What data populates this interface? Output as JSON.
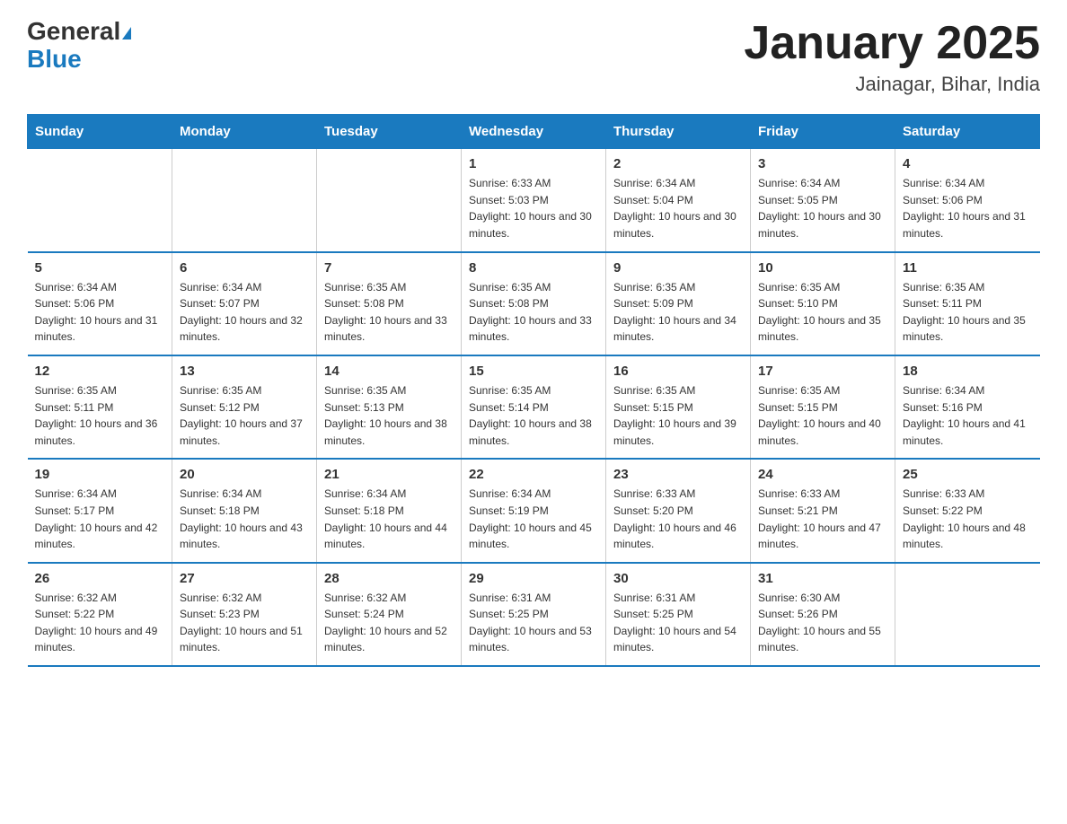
{
  "header": {
    "logo_general": "General",
    "logo_blue": "Blue",
    "month_title": "January 2025",
    "location": "Jainagar, Bihar, India"
  },
  "days_of_week": [
    "Sunday",
    "Monday",
    "Tuesday",
    "Wednesday",
    "Thursday",
    "Friday",
    "Saturday"
  ],
  "weeks": [
    [
      {
        "day": "",
        "sunrise": "",
        "sunset": "",
        "daylight": ""
      },
      {
        "day": "",
        "sunrise": "",
        "sunset": "",
        "daylight": ""
      },
      {
        "day": "",
        "sunrise": "",
        "sunset": "",
        "daylight": ""
      },
      {
        "day": "1",
        "sunrise": "Sunrise: 6:33 AM",
        "sunset": "Sunset: 5:03 PM",
        "daylight": "Daylight: 10 hours and 30 minutes."
      },
      {
        "day": "2",
        "sunrise": "Sunrise: 6:34 AM",
        "sunset": "Sunset: 5:04 PM",
        "daylight": "Daylight: 10 hours and 30 minutes."
      },
      {
        "day": "3",
        "sunrise": "Sunrise: 6:34 AM",
        "sunset": "Sunset: 5:05 PM",
        "daylight": "Daylight: 10 hours and 30 minutes."
      },
      {
        "day": "4",
        "sunrise": "Sunrise: 6:34 AM",
        "sunset": "Sunset: 5:06 PM",
        "daylight": "Daylight: 10 hours and 31 minutes."
      }
    ],
    [
      {
        "day": "5",
        "sunrise": "Sunrise: 6:34 AM",
        "sunset": "Sunset: 5:06 PM",
        "daylight": "Daylight: 10 hours and 31 minutes."
      },
      {
        "day": "6",
        "sunrise": "Sunrise: 6:34 AM",
        "sunset": "Sunset: 5:07 PM",
        "daylight": "Daylight: 10 hours and 32 minutes."
      },
      {
        "day": "7",
        "sunrise": "Sunrise: 6:35 AM",
        "sunset": "Sunset: 5:08 PM",
        "daylight": "Daylight: 10 hours and 33 minutes."
      },
      {
        "day": "8",
        "sunrise": "Sunrise: 6:35 AM",
        "sunset": "Sunset: 5:08 PM",
        "daylight": "Daylight: 10 hours and 33 minutes."
      },
      {
        "day": "9",
        "sunrise": "Sunrise: 6:35 AM",
        "sunset": "Sunset: 5:09 PM",
        "daylight": "Daylight: 10 hours and 34 minutes."
      },
      {
        "day": "10",
        "sunrise": "Sunrise: 6:35 AM",
        "sunset": "Sunset: 5:10 PM",
        "daylight": "Daylight: 10 hours and 35 minutes."
      },
      {
        "day": "11",
        "sunrise": "Sunrise: 6:35 AM",
        "sunset": "Sunset: 5:11 PM",
        "daylight": "Daylight: 10 hours and 35 minutes."
      }
    ],
    [
      {
        "day": "12",
        "sunrise": "Sunrise: 6:35 AM",
        "sunset": "Sunset: 5:11 PM",
        "daylight": "Daylight: 10 hours and 36 minutes."
      },
      {
        "day": "13",
        "sunrise": "Sunrise: 6:35 AM",
        "sunset": "Sunset: 5:12 PM",
        "daylight": "Daylight: 10 hours and 37 minutes."
      },
      {
        "day": "14",
        "sunrise": "Sunrise: 6:35 AM",
        "sunset": "Sunset: 5:13 PM",
        "daylight": "Daylight: 10 hours and 38 minutes."
      },
      {
        "day": "15",
        "sunrise": "Sunrise: 6:35 AM",
        "sunset": "Sunset: 5:14 PM",
        "daylight": "Daylight: 10 hours and 38 minutes."
      },
      {
        "day": "16",
        "sunrise": "Sunrise: 6:35 AM",
        "sunset": "Sunset: 5:15 PM",
        "daylight": "Daylight: 10 hours and 39 minutes."
      },
      {
        "day": "17",
        "sunrise": "Sunrise: 6:35 AM",
        "sunset": "Sunset: 5:15 PM",
        "daylight": "Daylight: 10 hours and 40 minutes."
      },
      {
        "day": "18",
        "sunrise": "Sunrise: 6:34 AM",
        "sunset": "Sunset: 5:16 PM",
        "daylight": "Daylight: 10 hours and 41 minutes."
      }
    ],
    [
      {
        "day": "19",
        "sunrise": "Sunrise: 6:34 AM",
        "sunset": "Sunset: 5:17 PM",
        "daylight": "Daylight: 10 hours and 42 minutes."
      },
      {
        "day": "20",
        "sunrise": "Sunrise: 6:34 AM",
        "sunset": "Sunset: 5:18 PM",
        "daylight": "Daylight: 10 hours and 43 minutes."
      },
      {
        "day": "21",
        "sunrise": "Sunrise: 6:34 AM",
        "sunset": "Sunset: 5:18 PM",
        "daylight": "Daylight: 10 hours and 44 minutes."
      },
      {
        "day": "22",
        "sunrise": "Sunrise: 6:34 AM",
        "sunset": "Sunset: 5:19 PM",
        "daylight": "Daylight: 10 hours and 45 minutes."
      },
      {
        "day": "23",
        "sunrise": "Sunrise: 6:33 AM",
        "sunset": "Sunset: 5:20 PM",
        "daylight": "Daylight: 10 hours and 46 minutes."
      },
      {
        "day": "24",
        "sunrise": "Sunrise: 6:33 AM",
        "sunset": "Sunset: 5:21 PM",
        "daylight": "Daylight: 10 hours and 47 minutes."
      },
      {
        "day": "25",
        "sunrise": "Sunrise: 6:33 AM",
        "sunset": "Sunset: 5:22 PM",
        "daylight": "Daylight: 10 hours and 48 minutes."
      }
    ],
    [
      {
        "day": "26",
        "sunrise": "Sunrise: 6:32 AM",
        "sunset": "Sunset: 5:22 PM",
        "daylight": "Daylight: 10 hours and 49 minutes."
      },
      {
        "day": "27",
        "sunrise": "Sunrise: 6:32 AM",
        "sunset": "Sunset: 5:23 PM",
        "daylight": "Daylight: 10 hours and 51 minutes."
      },
      {
        "day": "28",
        "sunrise": "Sunrise: 6:32 AM",
        "sunset": "Sunset: 5:24 PM",
        "daylight": "Daylight: 10 hours and 52 minutes."
      },
      {
        "day": "29",
        "sunrise": "Sunrise: 6:31 AM",
        "sunset": "Sunset: 5:25 PM",
        "daylight": "Daylight: 10 hours and 53 minutes."
      },
      {
        "day": "30",
        "sunrise": "Sunrise: 6:31 AM",
        "sunset": "Sunset: 5:25 PM",
        "daylight": "Daylight: 10 hours and 54 minutes."
      },
      {
        "day": "31",
        "sunrise": "Sunrise: 6:30 AM",
        "sunset": "Sunset: 5:26 PM",
        "daylight": "Daylight: 10 hours and 55 minutes."
      },
      {
        "day": "",
        "sunrise": "",
        "sunset": "",
        "daylight": ""
      }
    ]
  ]
}
